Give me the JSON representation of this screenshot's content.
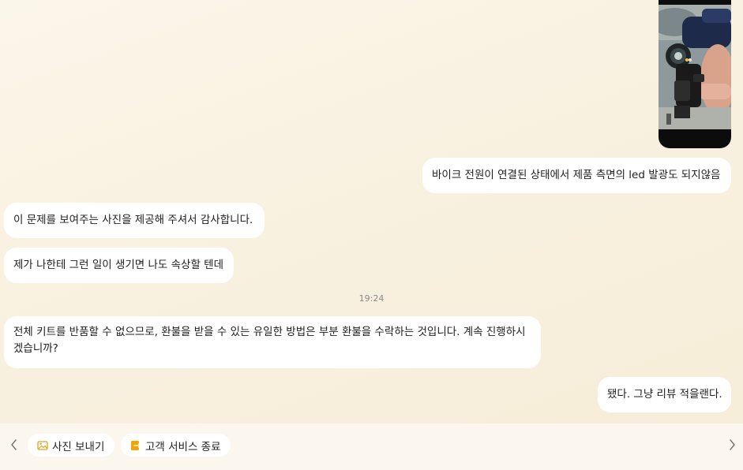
{
  "messages": {
    "user_1": "바이크 전원이 연결된 상태에서 제품 측면의 led 발광도 되지않음",
    "agent_1": "이 문제를 보여주는 사진을 제공해 주셔서 감사합니다.",
    "agent_2": "제가 나한테 그런 일이 생기면 나도 속상할 텐데",
    "timestamp": "19:24",
    "agent_3_line1": "전체 키트를 반품할 수 없으므로, 환불을 받을 수 있는 유일한 방법은 부분 환불을 수락하는 것입니다. 계속 진행하시",
    "agent_3_line2": "겠습니까?",
    "user_2": "됐다. 그냥 리뷰 적을랜다."
  },
  "quick_actions": {
    "send_photo": "사진 보내기",
    "end_service": "고객 서비스 종료"
  },
  "colors": {
    "bubble": "#ffffff",
    "icon_accent": "#f0a500"
  },
  "icons": [
    "image-icon",
    "exit-document-icon",
    "chevron-left-icon",
    "chevron-right-icon"
  ]
}
